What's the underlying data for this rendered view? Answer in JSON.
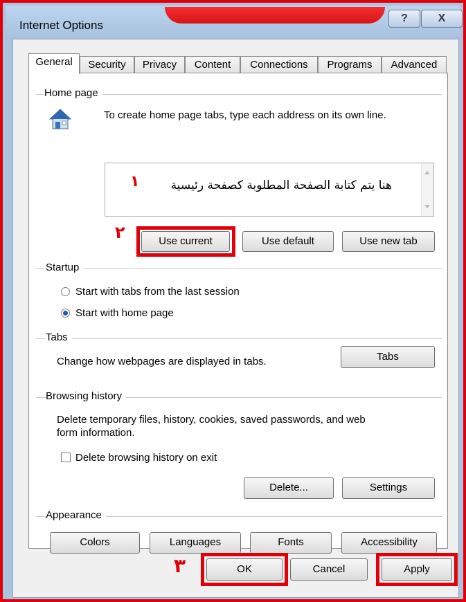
{
  "window": {
    "title": "Internet Options",
    "help_label": "?",
    "close_label": "X"
  },
  "tabs": [
    {
      "label": "General",
      "active": true
    },
    {
      "label": "Security"
    },
    {
      "label": "Privacy"
    },
    {
      "label": "Content"
    },
    {
      "label": "Connections"
    },
    {
      "label": "Programs"
    },
    {
      "label": "Advanced"
    }
  ],
  "home_page": {
    "group_label": "Home page",
    "instructions": "To create home page tabs, type each address on its own line.",
    "textarea_text": "هنا يتم كتابة الصفحة المطلوبة كصفحة رئيسية",
    "annotation": "١",
    "use_current": "Use current",
    "use_default": "Use default",
    "use_new_tab": "Use new tab",
    "annotation_buttons": "٢"
  },
  "startup": {
    "group_label": "Startup",
    "option_last_session": "Start with tabs from the last session",
    "option_home_page": "Start with home page",
    "selected": "home_page"
  },
  "tabs_group": {
    "group_label": "Tabs",
    "description": "Change how webpages are displayed in tabs.",
    "tabs_button": "Tabs"
  },
  "browsing_history": {
    "group_label": "Browsing history",
    "description_line1": "Delete temporary files, history, cookies, saved passwords, and web",
    "description_line2": "form information.",
    "delete_on_exit": "Delete browsing history on exit",
    "delete_on_exit_checked": false,
    "delete_button": "Delete...",
    "settings_button": "Settings"
  },
  "appearance": {
    "group_label": "Appearance",
    "colors": "Colors",
    "languages": "Languages",
    "fonts": "Fonts",
    "accessibility": "Accessibility"
  },
  "footer": {
    "ok": "OK",
    "cancel": "Cancel",
    "apply": "Apply",
    "annotation": "٣"
  },
  "colors": {
    "highlight": "#e0000a",
    "selected_radio": "#2059a8"
  }
}
